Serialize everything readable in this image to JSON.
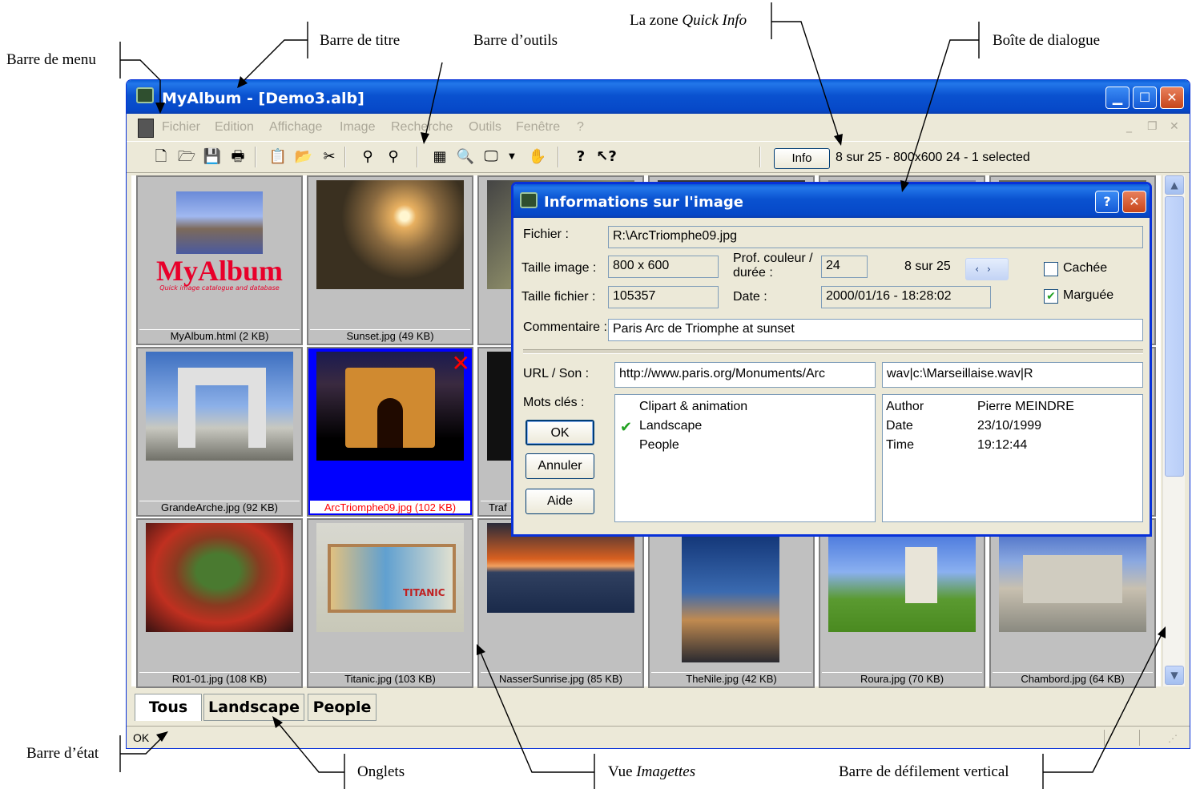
{
  "annotations": {
    "barre_menu": "Barre de menu",
    "barre_titre": "Barre de titre",
    "barre_outils": "Barre d’outils",
    "quick_info_zone": "La zone",
    "quick_info_em": "Quick Info",
    "boite_dialogue": "Boîte de dialogue",
    "barre_etat": "Barre d’état",
    "onglets": "Onglets",
    "vue": "Vue",
    "vue_em": "Imagettes",
    "barre_defilement": "Barre de défilement vertical"
  },
  "window": {
    "title": "MyAlbum - [Demo3.alb]"
  },
  "menu": [
    "Fichier",
    "Edition",
    "Affichage",
    "Image",
    "Recherche",
    "Outils",
    "Fenêtre",
    "?"
  ],
  "toolbar": {
    "info_label": "Info",
    "quick_info": "8 sur 25 - 800x600 24 - 1 selected"
  },
  "thumbnails": [
    {
      "caption": "MyAlbum.html (2 KB)",
      "logo": "MyAlbum",
      "tagline": "Quick image catalogue and database"
    },
    {
      "caption": "Sunset.jpg (49 KB)"
    },
    {
      "caption": "GrandeArche.jpg (92 KB)"
    },
    {
      "caption": "ArcTriomphe09.jpg (102 KB)",
      "selected": true
    },
    {
      "caption": "Traf"
    },
    {
      "caption": "R01-01.jpg (108 KB)"
    },
    {
      "caption": "Titanic.jpg (103 KB)",
      "sign": "TITANIC"
    },
    {
      "caption": "NasserSunrise.jpg (85 KB)"
    },
    {
      "caption": "TheNile.jpg (42 KB)"
    },
    {
      "caption": "Roura.jpg (70 KB)"
    },
    {
      "caption": "Chambord.jpg (64 KB)"
    }
  ],
  "tabs": [
    "Tous",
    "Landscape",
    "People"
  ],
  "status": {
    "text": "OK"
  },
  "dialog": {
    "title": "Informations sur l'image",
    "help_glyph": "?",
    "fichier_label": "Fichier :",
    "fichier_value": "R:\\ArcTriomphe09.jpg",
    "taille_image_label": "Taille image :",
    "taille_image_value": "800 x 600",
    "prof_label_1": "Prof. couleur /",
    "prof_label_2": "durée :",
    "prof_value": "24",
    "position": "8  sur 25",
    "cachee_label": "Cachée",
    "cachee_checked": false,
    "marquee_label": "Marguée",
    "marquee_checked": true,
    "taille_fichier_label": "Taille fichier :",
    "taille_fichier_value": "105357",
    "date_label": "Date :",
    "date_value": "2000/01/16 - 18:28:02",
    "commentaire_label": "Commentaire :",
    "commentaire_value": "Paris Arc de Triomphe at sunset",
    "url_label": "URL / Son :",
    "url_value": "http://www.paris.org/Monuments/Arc",
    "son_value": "wav|c:\\Marseillaise.wav|R",
    "mots_cles_label": "Mots clés :",
    "keywords": [
      {
        "label": "Clipart & animation",
        "checked": false
      },
      {
        "label": "Landscape",
        "checked": true
      },
      {
        "label": "People",
        "checked": false
      }
    ],
    "meta": [
      {
        "k": "Author",
        "v": "Pierre MEINDRE"
      },
      {
        "k": "Date",
        "v": "23/10/1999"
      },
      {
        "k": "Time",
        "v": "19:12:44"
      }
    ],
    "ok_label": "OK",
    "annuler_label": "Annuler",
    "aide_label": "Aide"
  }
}
